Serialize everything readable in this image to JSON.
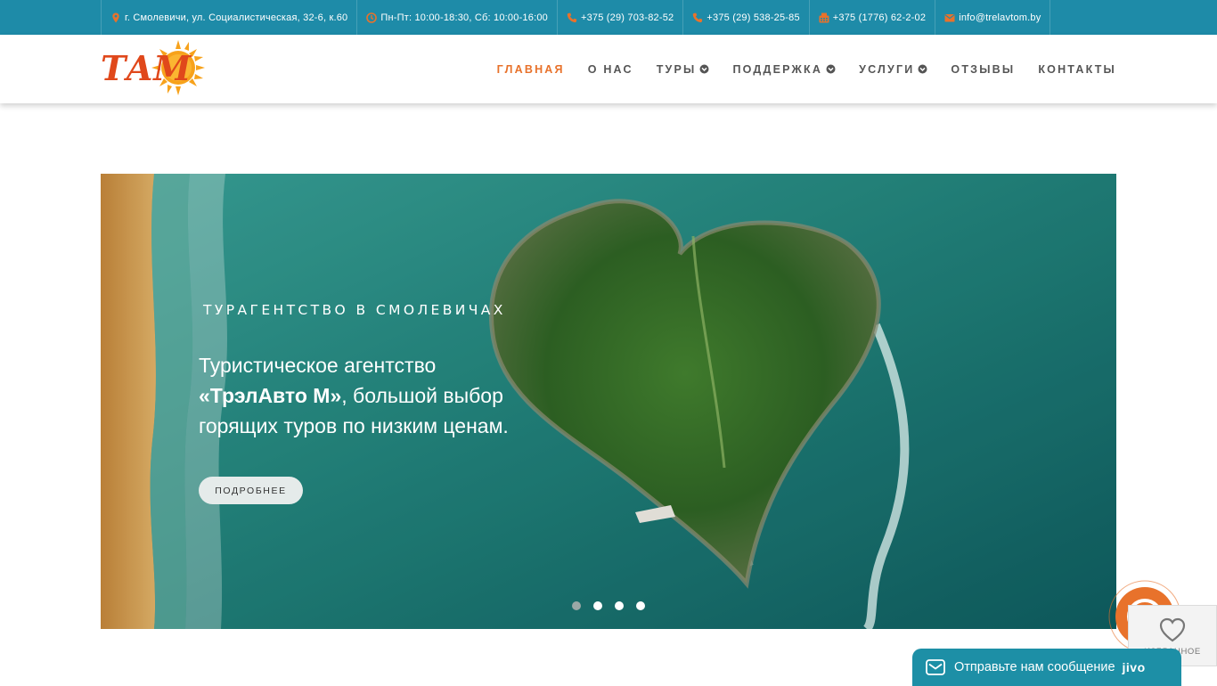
{
  "topbar": {
    "address": "г. Смолевичи, ул. Социалистическая, 32-6, к.60",
    "hours": "Пн-Пт: 10:00-18:30, Сб: 10:00-16:00",
    "phone1": "+375 (29) 703-82-52",
    "phone2": "+375 (29) 538-25-85",
    "fax": "+375 (1776) 62-2-02",
    "email": "info@trelavtom.by"
  },
  "header": {
    "logo_text": "ТАМ",
    "nav": [
      {
        "label": "Главная",
        "active": true,
        "dropdown": false
      },
      {
        "label": "О нас",
        "active": false,
        "dropdown": false
      },
      {
        "label": "Туры",
        "active": false,
        "dropdown": true
      },
      {
        "label": "Поддержка",
        "active": false,
        "dropdown": true
      },
      {
        "label": "Услуги",
        "active": false,
        "dropdown": true
      },
      {
        "label": "Отзывы",
        "active": false,
        "dropdown": false
      },
      {
        "label": "Контакты",
        "active": false,
        "dropdown": false
      }
    ]
  },
  "hero": {
    "eyebrow": "ТУРАГЕНТСТВО В СМОЛЕВИЧАХ",
    "text_line1": "Туристическое агентство",
    "brand": "«ТрэлАвто М»",
    "text_rest": ", большой выбор горящих туров по низким ценам.",
    "button_label": "ПОДРОБНЕЕ",
    "slides_total": 4,
    "active_slide": 1
  },
  "widgets": {
    "favorites_label": "ИЗБРАННОЕ",
    "chat_label": "Отправьте нам сообщение",
    "chat_brand": "jivo"
  },
  "colors": {
    "topbar_bg": "#1e8ba8",
    "accent": "#e8722b",
    "nav_text": "#555555",
    "chat_bg": "#1d8fa6"
  },
  "icons": {
    "address": "map-marker-icon",
    "hours": "clock-icon",
    "phone": "phone-icon",
    "fax": "fax-icon",
    "email": "envelope-icon",
    "dropdown": "chevron-circle-down-icon",
    "favorites": "heart-icon",
    "chat": "envelope-outline-icon",
    "callback": "phone-callback-icon"
  }
}
